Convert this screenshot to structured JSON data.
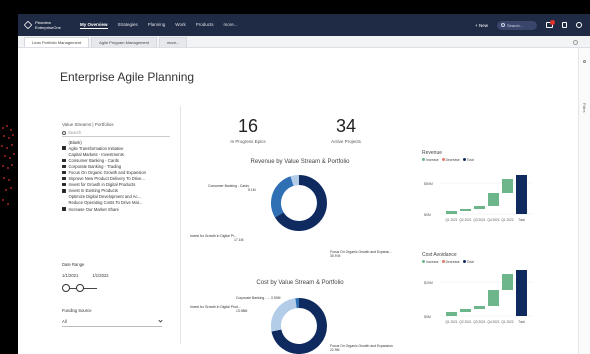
{
  "topbar": {
    "logo_line1": "Planview",
    "logo_line2": "EnterpriseOne",
    "nav": [
      "My Overview",
      "Strategies",
      "Planning",
      "Work",
      "Products",
      "more..."
    ],
    "new_label": "+ New",
    "search_placeholder": "Search..."
  },
  "tabs": [
    "Lean Portfolio Management",
    "Agile Program Management",
    "more..."
  ],
  "report": {
    "title": "Enterprise Agile Planning",
    "side_strip_label": "Filters"
  },
  "filters": {
    "header": "Value Streams | Portfolios",
    "search_placeholder": "Search",
    "items": [
      {
        "label": "(Blank)",
        "checked": false,
        "box": false
      },
      {
        "label": "Agile Transformation Initiative",
        "checked": true,
        "box": true
      },
      {
        "label": "Capital Markets - Investments",
        "checked": false,
        "box": false
      },
      {
        "label": "Consumer Banking - Cards",
        "checked": true,
        "box": true
      },
      {
        "label": "Corporate Banking - Trading",
        "checked": true,
        "box": true
      },
      {
        "label": "Focus On Organic Growth and Expansion",
        "checked": true,
        "box": true
      },
      {
        "label": "Improve New Product Delivery To Drive...",
        "checked": true,
        "box": true
      },
      {
        "label": "Invest for Growth in Digital Products",
        "checked": true,
        "box": true
      },
      {
        "label": "Invest In Existing Products",
        "checked": true,
        "box": true
      },
      {
        "label": "Optimize Digital Development and Ac...",
        "checked": false,
        "box": false
      },
      {
        "label": "Reduce Operating Costs To Drive Mar...",
        "checked": false,
        "box": false
      },
      {
        "label": "Increase Our Market Share",
        "checked": true,
        "box": true
      }
    ]
  },
  "date_range": {
    "label": "Date Range",
    "start": "1/1/2021",
    "end": "1/1/2022"
  },
  "funding": {
    "label": "Funding Source",
    "value": "All"
  },
  "kpis": [
    {
      "value": "16",
      "label": "In Progress Epics"
    },
    {
      "value": "34",
      "label": "Active Projects"
    }
  ],
  "donut_revenue": {
    "title": "Revenue by Value Stream & Portfolio",
    "labels": [
      {
        "name": "Consumer Banking - Cards",
        "value": "5.1M"
      },
      {
        "name": "Invest for Growth in Digital Pr...",
        "value": "17.1M"
      },
      {
        "name": "Focus On Organic Growth and Expansi...",
        "value": "30.9 M"
      }
    ]
  },
  "donut_cost": {
    "title": "Cost by Value Stream & Portfolio",
    "labels": [
      {
        "name": "Corporate Banking - ...",
        "value": "0.90M"
      },
      {
        "name": "Invest for Growth in Digital Prod...",
        "value": "13.98M"
      },
      {
        "name": "Focus On Organic Growth and Expansion",
        "value": "22.9M"
      }
    ]
  },
  "waterfall_revenue": {
    "title": "Revenue",
    "legend": [
      "Increase",
      "Decrease",
      "Total"
    ],
    "y_ticks": [
      "$0M",
      "$50M"
    ],
    "x": [
      "Q1 2021",
      "Q2 2021",
      "Q3 2021",
      "Q4 2021",
      "Q1 2022",
      "Total"
    ]
  },
  "waterfall_cost": {
    "title": "Cost Avoidance",
    "legend": [
      "Increase",
      "Decrease",
      "Total"
    ],
    "y_ticks": [
      "$0M",
      "$20M"
    ],
    "x": [
      "Q1 2021",
      "Q2 2021",
      "Q3 2021",
      "Q4 2021",
      "Q1 2022",
      "Total"
    ]
  },
  "colors": {
    "navy": "#0f2a5e",
    "mid": "#2f6fb4",
    "light": "#b3cde8",
    "green": "#6db58a",
    "topbar": "#1f2a44"
  }
}
